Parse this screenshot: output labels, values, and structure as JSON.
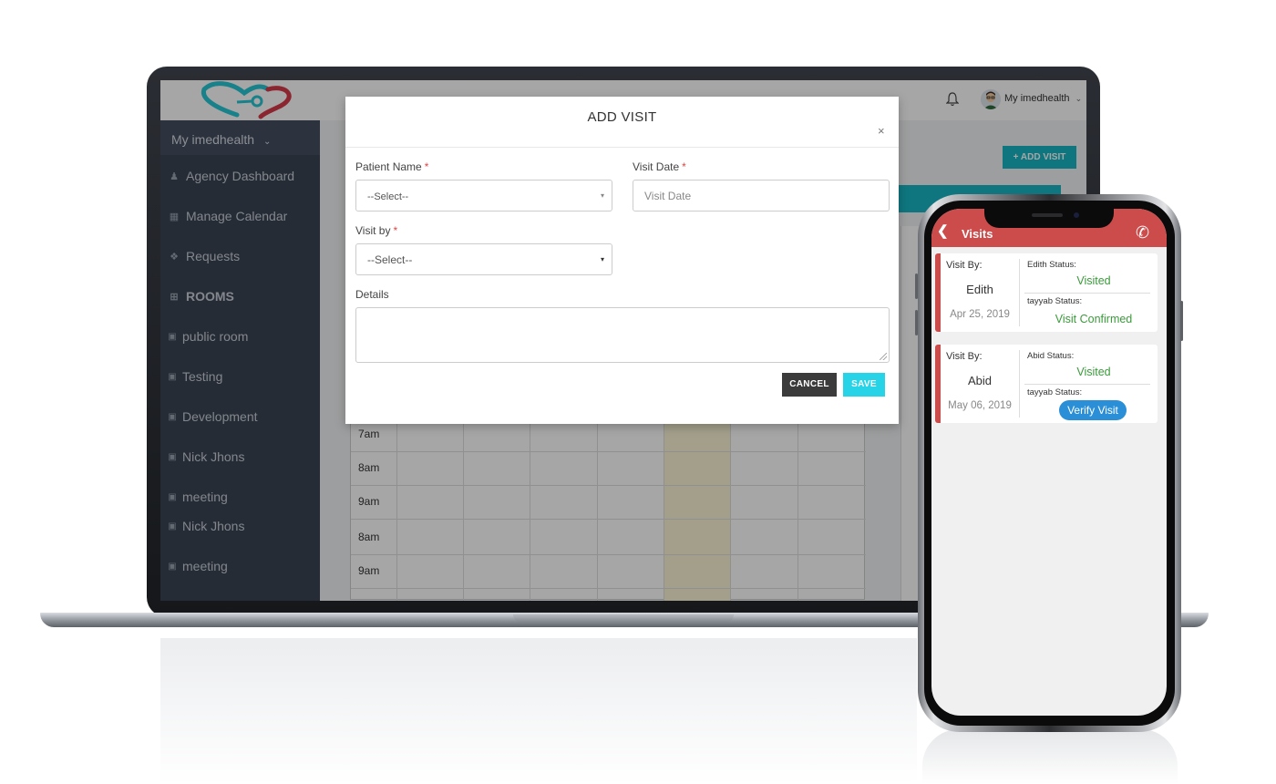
{
  "web": {
    "user_name": "My imedhealth",
    "sidebar": {
      "header": "My imedhealth",
      "items": [
        {
          "label": "Agency Dashboard",
          "icon": "user-icon"
        },
        {
          "label": "Manage Calendar",
          "icon": "calendar-icon"
        },
        {
          "label": "Requests",
          "icon": "tags-icon"
        },
        {
          "label": "ROOMS",
          "icon": "plus-square-icon"
        },
        {
          "label": "public room",
          "icon": "chat-icon"
        },
        {
          "label": "Testing",
          "icon": "chat-icon"
        },
        {
          "label": "Development",
          "icon": "chat-icon"
        },
        {
          "label": "Nick Jhons",
          "icon": "chat-icon"
        },
        {
          "label": "meeting",
          "icon": "chat-icon"
        },
        {
          "label": "Nick Jhons",
          "icon": "chat-icon"
        },
        {
          "label": "meeting",
          "icon": "chat-icon"
        }
      ]
    },
    "add_visit_button": "+ ADD VISIT",
    "calendar_times": [
      "7am",
      "8am",
      "9am",
      "8am",
      "9am"
    ],
    "modal": {
      "title": "ADD VISIT",
      "close": "×",
      "patient_name_label": "Patient Name",
      "patient_name_value": "--Select--",
      "visit_date_label": "Visit Date",
      "visit_date_placeholder": "Visit Date",
      "visit_by_label": "Visit by",
      "visit_by_value": "--Select--",
      "details_label": "Details",
      "required_mark": "*",
      "cancel": "CANCEL",
      "save": "SAVE"
    },
    "colors": {
      "accent": "#18b6c4",
      "sidebar": "#3b4453",
      "save": "#27d3e6",
      "required": "#e04545"
    }
  },
  "mobile": {
    "title": "Visits",
    "visits": [
      {
        "by_label": "Visit By:",
        "by_name": "Edith",
        "date": "Apr 25, 2019",
        "status1_label": "Edith Status:",
        "status1": "Visited",
        "status2_label": "tayyab Status:",
        "status2": "Visit Confirmed"
      },
      {
        "by_label": "Visit By:",
        "by_name": "Abid",
        "date": "May 06, 2019",
        "status1_label": "Abid Status:",
        "status1": "Visited",
        "status2_label": "tayyab Status:",
        "status2_button": "Verify Visit"
      }
    ],
    "colors": {
      "header": "#cc4b4b",
      "status_ok": "#3a9b3a",
      "verify": "#2a8fd6"
    }
  }
}
